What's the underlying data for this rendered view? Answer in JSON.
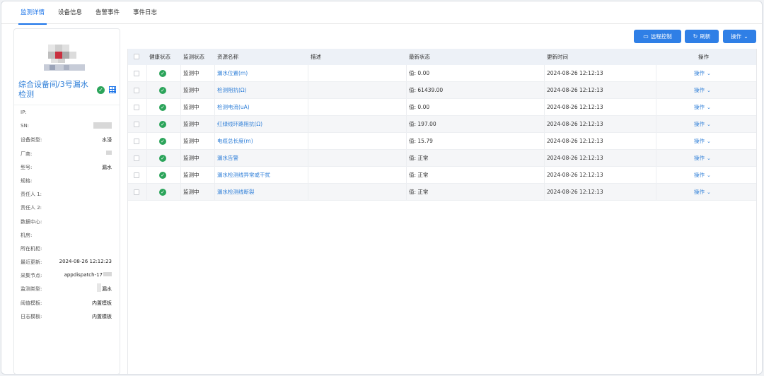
{
  "tabs": [
    {
      "label": "监测详情",
      "active": true
    },
    {
      "label": "设备信息",
      "active": false
    },
    {
      "label": "告警事件",
      "active": false
    },
    {
      "label": "事件日志",
      "active": false
    }
  ],
  "device": {
    "title": "综合设备间/3号漏水检测",
    "status_icon": "check-circle-icon",
    "view_icon": "grid-icon",
    "info": [
      {
        "label": "IP:",
        "value": ""
      },
      {
        "label": "SN:",
        "value": ""
      },
      {
        "label": "设备类型:",
        "value": "水浸"
      },
      {
        "label": "厂商:",
        "value": ""
      },
      {
        "label": "型号:",
        "value": "漏水"
      },
      {
        "label": "规格:",
        "value": ""
      },
      {
        "label": "责任人 1:",
        "value": ""
      },
      {
        "label": "责任人 2:",
        "value": ""
      },
      {
        "label": "数据中心:",
        "value": ""
      },
      {
        "label": "机房:",
        "value": ""
      },
      {
        "label": "所在机柜:",
        "value": ""
      },
      {
        "label": "最近更新:",
        "value": "2024-08-26 12:12:23"
      },
      {
        "label": "采集节点:",
        "value": "appdispatch-17"
      },
      {
        "label": "监测类型:",
        "value": "漏水"
      },
      {
        "label": "阈值模板:",
        "value": "内置模板"
      },
      {
        "label": "日志模板:",
        "value": "内置模板"
      }
    ]
  },
  "toolbar": {
    "remote_label": "远程控制",
    "refresh_label": "刷新",
    "ops_label": "操作"
  },
  "table": {
    "columns": [
      "健康状态",
      "监测状态",
      "资源名称",
      "描述",
      "最新状态",
      "更新时间",
      "操作"
    ],
    "rows": [
      {
        "monitor": "监测中",
        "name": "漏水位置(m)",
        "desc": "",
        "latest": "值: 0.00",
        "time": "2024-08-26 12:12:13",
        "op": "操作"
      },
      {
        "monitor": "监测中",
        "name": "检测阻抗(Ω)",
        "desc": "",
        "latest": "值: 61439.00",
        "time": "2024-08-26 12:12:13",
        "op": "操作"
      },
      {
        "monitor": "监测中",
        "name": "检测电流(uA)",
        "desc": "",
        "latest": "值: 0.00",
        "time": "2024-08-26 12:12:13",
        "op": "操作"
      },
      {
        "monitor": "监测中",
        "name": "红绿线环路阻抗(Ω)",
        "desc": "",
        "latest": "值: 197.00",
        "time": "2024-08-26 12:12:13",
        "op": "操作"
      },
      {
        "monitor": "监测中",
        "name": "电缆总长度(m)",
        "desc": "",
        "latest": "值: 15.79",
        "time": "2024-08-26 12:12:13",
        "op": "操作"
      },
      {
        "monitor": "监测中",
        "name": "漏水告警",
        "desc": "",
        "latest": "值: 正常",
        "time": "2024-08-26 12:12:13",
        "op": "操作"
      },
      {
        "monitor": "监测中",
        "name": "漏水检测线异常或干扰",
        "desc": "",
        "latest": "值: 正常",
        "time": "2024-08-26 12:12:13",
        "op": "操作"
      },
      {
        "monitor": "监测中",
        "name": "漏水检测线断裂",
        "desc": "",
        "latest": "值: 正常",
        "time": "2024-08-26 12:12:13",
        "op": "操作"
      }
    ]
  },
  "colors": {
    "accent": "#2f7fe6",
    "healthy": "#2ba45a",
    "header_bg": "#edf1f7"
  }
}
